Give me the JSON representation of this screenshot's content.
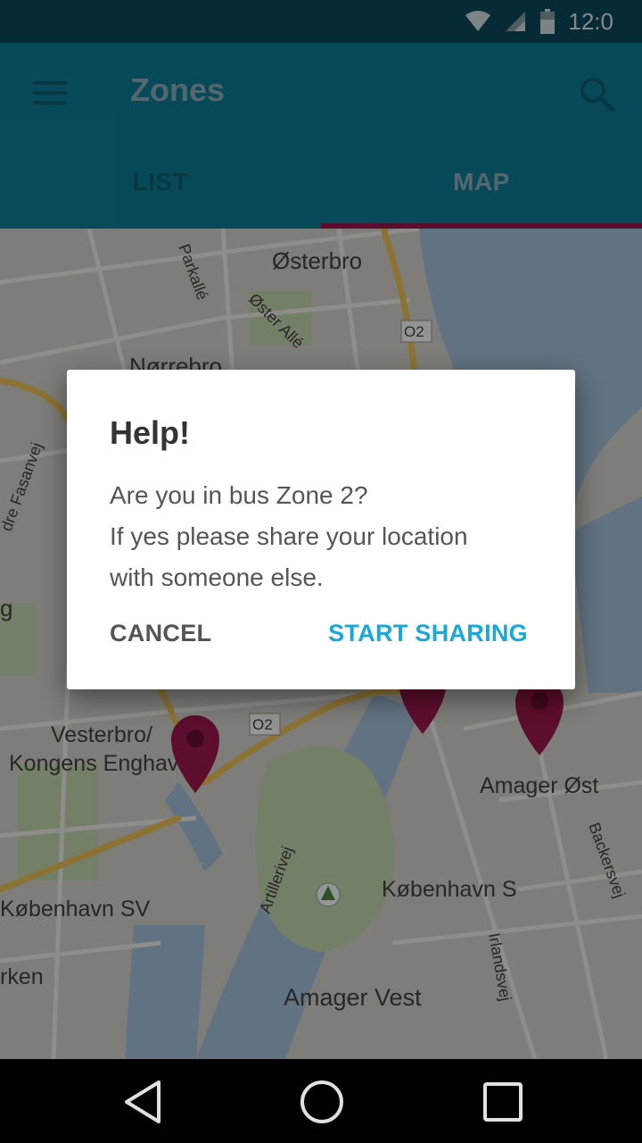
{
  "status_bar": {
    "time": "12:0",
    "icons": [
      "wifi-icon",
      "signal-icon",
      "battery-icon"
    ]
  },
  "app_bar": {
    "title": "Zones",
    "menu_icon": "menu-icon",
    "search_icon": "search-icon"
  },
  "tabs": [
    {
      "label": "LIST",
      "selected": false
    },
    {
      "label": "MAP",
      "selected": true
    }
  ],
  "map": {
    "labels": {
      "osterbro": "Østerbro",
      "norrebro": "Nørrebro",
      "parkalle": "Parkallé",
      "oster_alle": "Øster Allé",
      "fasanvej": "dre Fasanvej",
      "vesterbro": "Vesterbro/",
      "kongens": "Kongens Enghave",
      "amager_ost": "Amager Øst",
      "kobenhavn_s": "København S",
      "kobenhavn_sv": "København SV",
      "amager_vest": "Amager Vest",
      "backersvej": "Backersvej",
      "irlandsvej": "Irlandsvej",
      "artillerivej": "Artillerivej",
      "rken": "rken",
      "g": "g",
      "o2_a": "O2",
      "o2_b": "O2"
    },
    "marker_color": "#a0174f"
  },
  "dialog": {
    "title": "Help!",
    "lines": [
      "Are you in bus Zone 2?",
      "If yes please share your location",
      "with someone else."
    ],
    "cancel_label": "CANCEL",
    "confirm_label": "START SHARING"
  },
  "nav_bar": {
    "icons": [
      "back-icon",
      "home-icon",
      "recents-icon"
    ]
  },
  "colors": {
    "primary": "#0f7f99",
    "accent": "#a0174f",
    "dialog_action": "#1aa8d8"
  }
}
